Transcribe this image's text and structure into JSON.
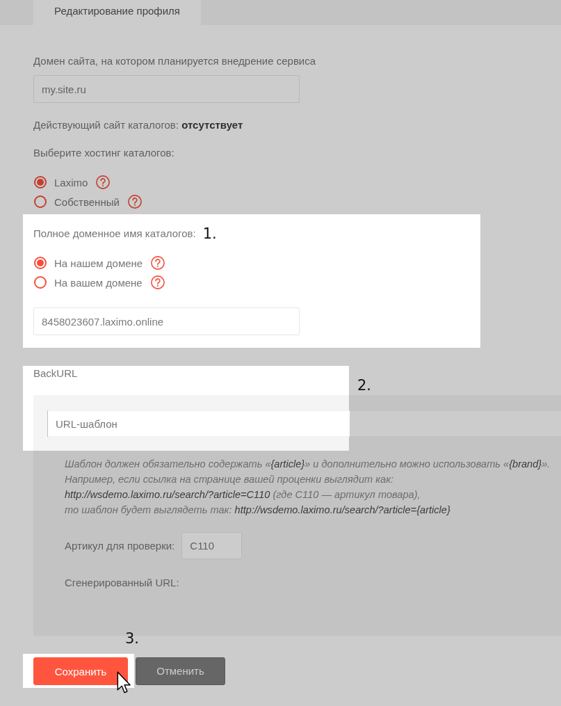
{
  "tabs": [
    {
      "label": "Редактирование профиля",
      "selected": true
    }
  ],
  "site_domain": {
    "label": "Домен сайта, на котором планируется внедрение сервиса",
    "value": "my.site.ru"
  },
  "current_catalog_site": "Действующий сайт каталогов: **отсутствует**",
  "hosting": {
    "label": "Выберите хостинг каталогов:",
    "options": [
      {
        "label": "Laximo",
        "selected": true
      },
      {
        "label": "Собственный",
        "selected": false
      }
    ]
  },
  "catalog_domain": {
    "highlighted": true,
    "label": "Полное доменное имя каталогов:",
    "step": "1.",
    "options": [
      {
        "label": "На нашем домене",
        "selected": true
      },
      {
        "label": "На вашем домене",
        "selected": false
      }
    ],
    "value": "8458023607.laximo.online"
  },
  "backurl": {
    "highlighted": true,
    "label": "BackURL",
    "step": "2.",
    "template": {
      "placeholder": "URL-шаблон"
    },
    "hint": [
      "Шаблон должен обязательно содержать «**{article}**» и дополнительно можно использовать «**{brand}**».",
      "Например, если ссылка на странице вашей проценки выглядит как:",
      "**http://wsdemo.laximo.ru/search/?article=C110** (где C110 — артикул товара),",
      "то шаблон будет выглядеть так: **http://wsdemo.laximo.ru/search/?article={article}**"
    ],
    "test_article": {
      "label": "Артикул для проверки:",
      "value": "C110"
    },
    "generated_url": {
      "label": "Сгенерированный URL:"
    }
  },
  "buttons": [
    {
      "label": "Сохранить",
      "kind": "primary",
      "highlighted": true,
      "step": "3."
    },
    {
      "label": "Отменить",
      "kind": "secondary",
      "highlighted": false
    }
  ]
}
